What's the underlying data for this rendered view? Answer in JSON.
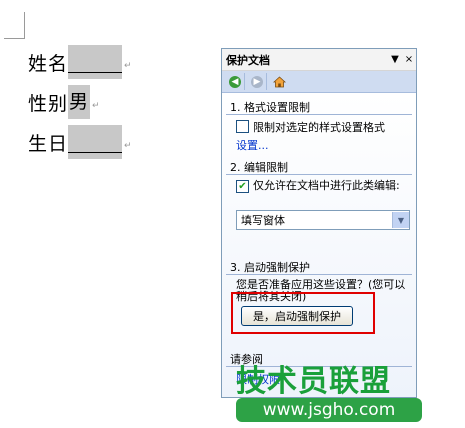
{
  "document": {
    "lines": [
      {
        "label": "姓名",
        "field_value": ""
      },
      {
        "label": "性别",
        "field_value": "男"
      },
      {
        "label": "生日",
        "field_value": ""
      }
    ]
  },
  "task_pane": {
    "title": "保护文档",
    "dropdown_icon": "▼",
    "close_icon": "×",
    "nav": [
      "back-icon",
      "forward-icon",
      "home-icon"
    ],
    "section1": {
      "header": "1. 格式设置限制",
      "checkbox_label": "限制对选定的样式设置格式",
      "checked": false,
      "link": "设置..."
    },
    "section2": {
      "header": "2. 编辑限制",
      "checkbox_label": "仅允许在文档中进行此类编辑:",
      "checked": true,
      "select_value": "填写窗体"
    },
    "section3": {
      "header": "3. 启动强制保护",
      "question": "您是否准备应用这些设置？(您可以稍后将其关闭)",
      "button_label": "是，启动强制保护"
    },
    "see_also": {
      "header": "请参阅",
      "link": "限制权限"
    }
  },
  "watermark": {
    "brand": "技术员联盟",
    "url": "www.jsgho.com"
  },
  "colors": {
    "highlight": "#e00000",
    "watermark_green": "#1aa03a",
    "pane_border": "#7f9db9"
  }
}
